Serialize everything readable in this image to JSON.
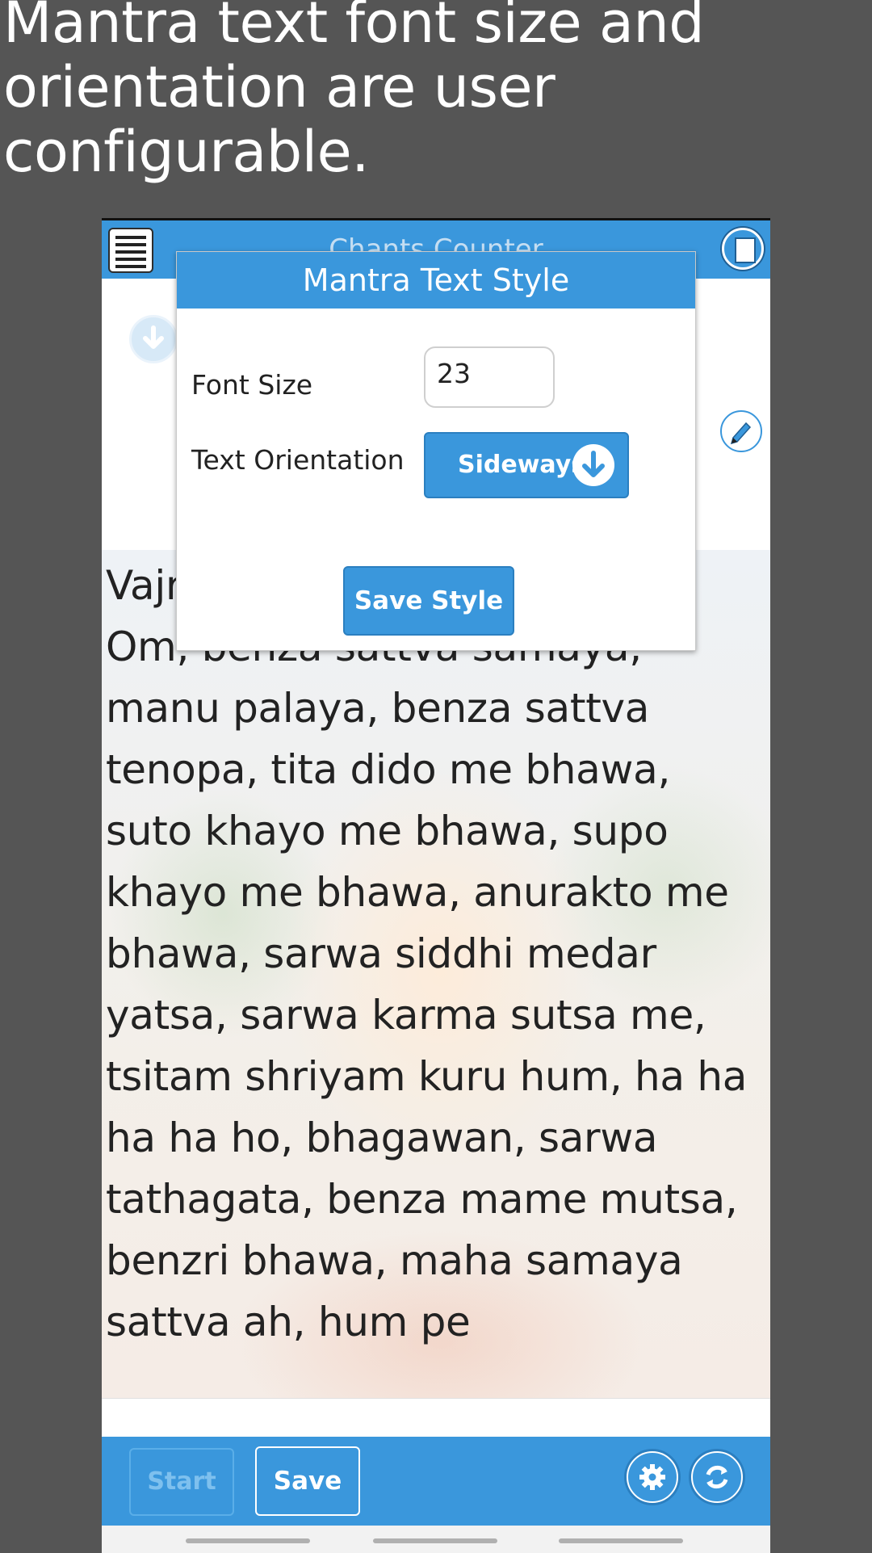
{
  "caption": {
    "line1": "Mantra text font size and",
    "line2": "orientation are user configurable."
  },
  "appbar": {
    "title": "Chants Counter",
    "menu_icon": "hamburger-menu-icon",
    "doc_icon": "document-icon"
  },
  "dialog": {
    "title": "Mantra Text Style",
    "font_size_label": "Font Size",
    "font_size_value": "23",
    "orientation_label": "Text Orientation",
    "orientation_value": "Sideways",
    "save_label": "Save Style"
  },
  "mantra": {
    "lines": [
      "Vajrasattva",
      "Om, benza sattva samaya,",
      "manu palaya, benza sattva",
      "tenopa, tita dido me bhawa,",
      "suto khayo me bhawa, supo",
      "khayo me bhawa, anurakto me",
      "bhawa, sarwa siddhi medar",
      "yatsa, sarwa karma sutsa me,",
      "tsitam shriyam kuru hum, ha ha",
      "ha ha ho, bhagawan, sarwa",
      "tathagata, benza mame mutsa,",
      "benzri bhawa, maha samaya",
      "sattva ah, hum pe"
    ]
  },
  "bottombar": {
    "start_label": "Start",
    "save_label": "Save",
    "settings_icon": "gear-icon",
    "reset_icon": "refresh-icon"
  },
  "colors": {
    "accent": "#3a97dc",
    "background": "#555555"
  }
}
